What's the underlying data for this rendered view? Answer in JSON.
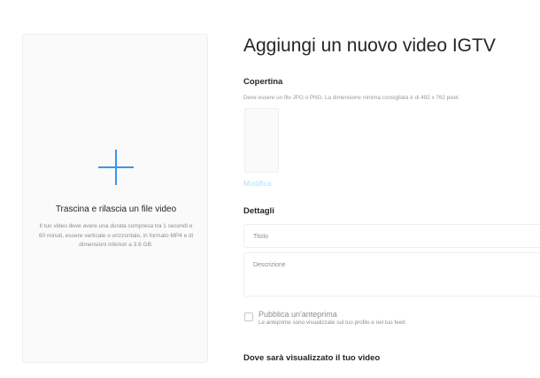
{
  "dropzone": {
    "title": "Trascina e rilascia un file video",
    "description": "Il tuo video deve avere una durata compresa tra 1 secondi e 60 minuti, essere verticale o orizzontale, in formato MP4 e di dimensioni inferiori a 3.6 GB.",
    "icon": "plus-icon",
    "accent": "#3897f0"
  },
  "header": {
    "title": "Aggiungi un nuovo video IGTV"
  },
  "cover": {
    "title": "Copertina",
    "description": "Deve essere un file JPG o PNG. La dimensione minima consigliata è di 492 x 762 pixel.",
    "modify_label": "Modifica"
  },
  "details": {
    "title": "Dettagli",
    "title_placeholder": "Titolo",
    "description_placeholder": "Descrizione"
  },
  "preview": {
    "label": "Pubblica un'anteprima",
    "sublabel": "Le anteprime sono visualizzate sul tuo profilo e nel tuo feed"
  },
  "where": {
    "title": "Dove sarà visualizzato il tuo video"
  }
}
